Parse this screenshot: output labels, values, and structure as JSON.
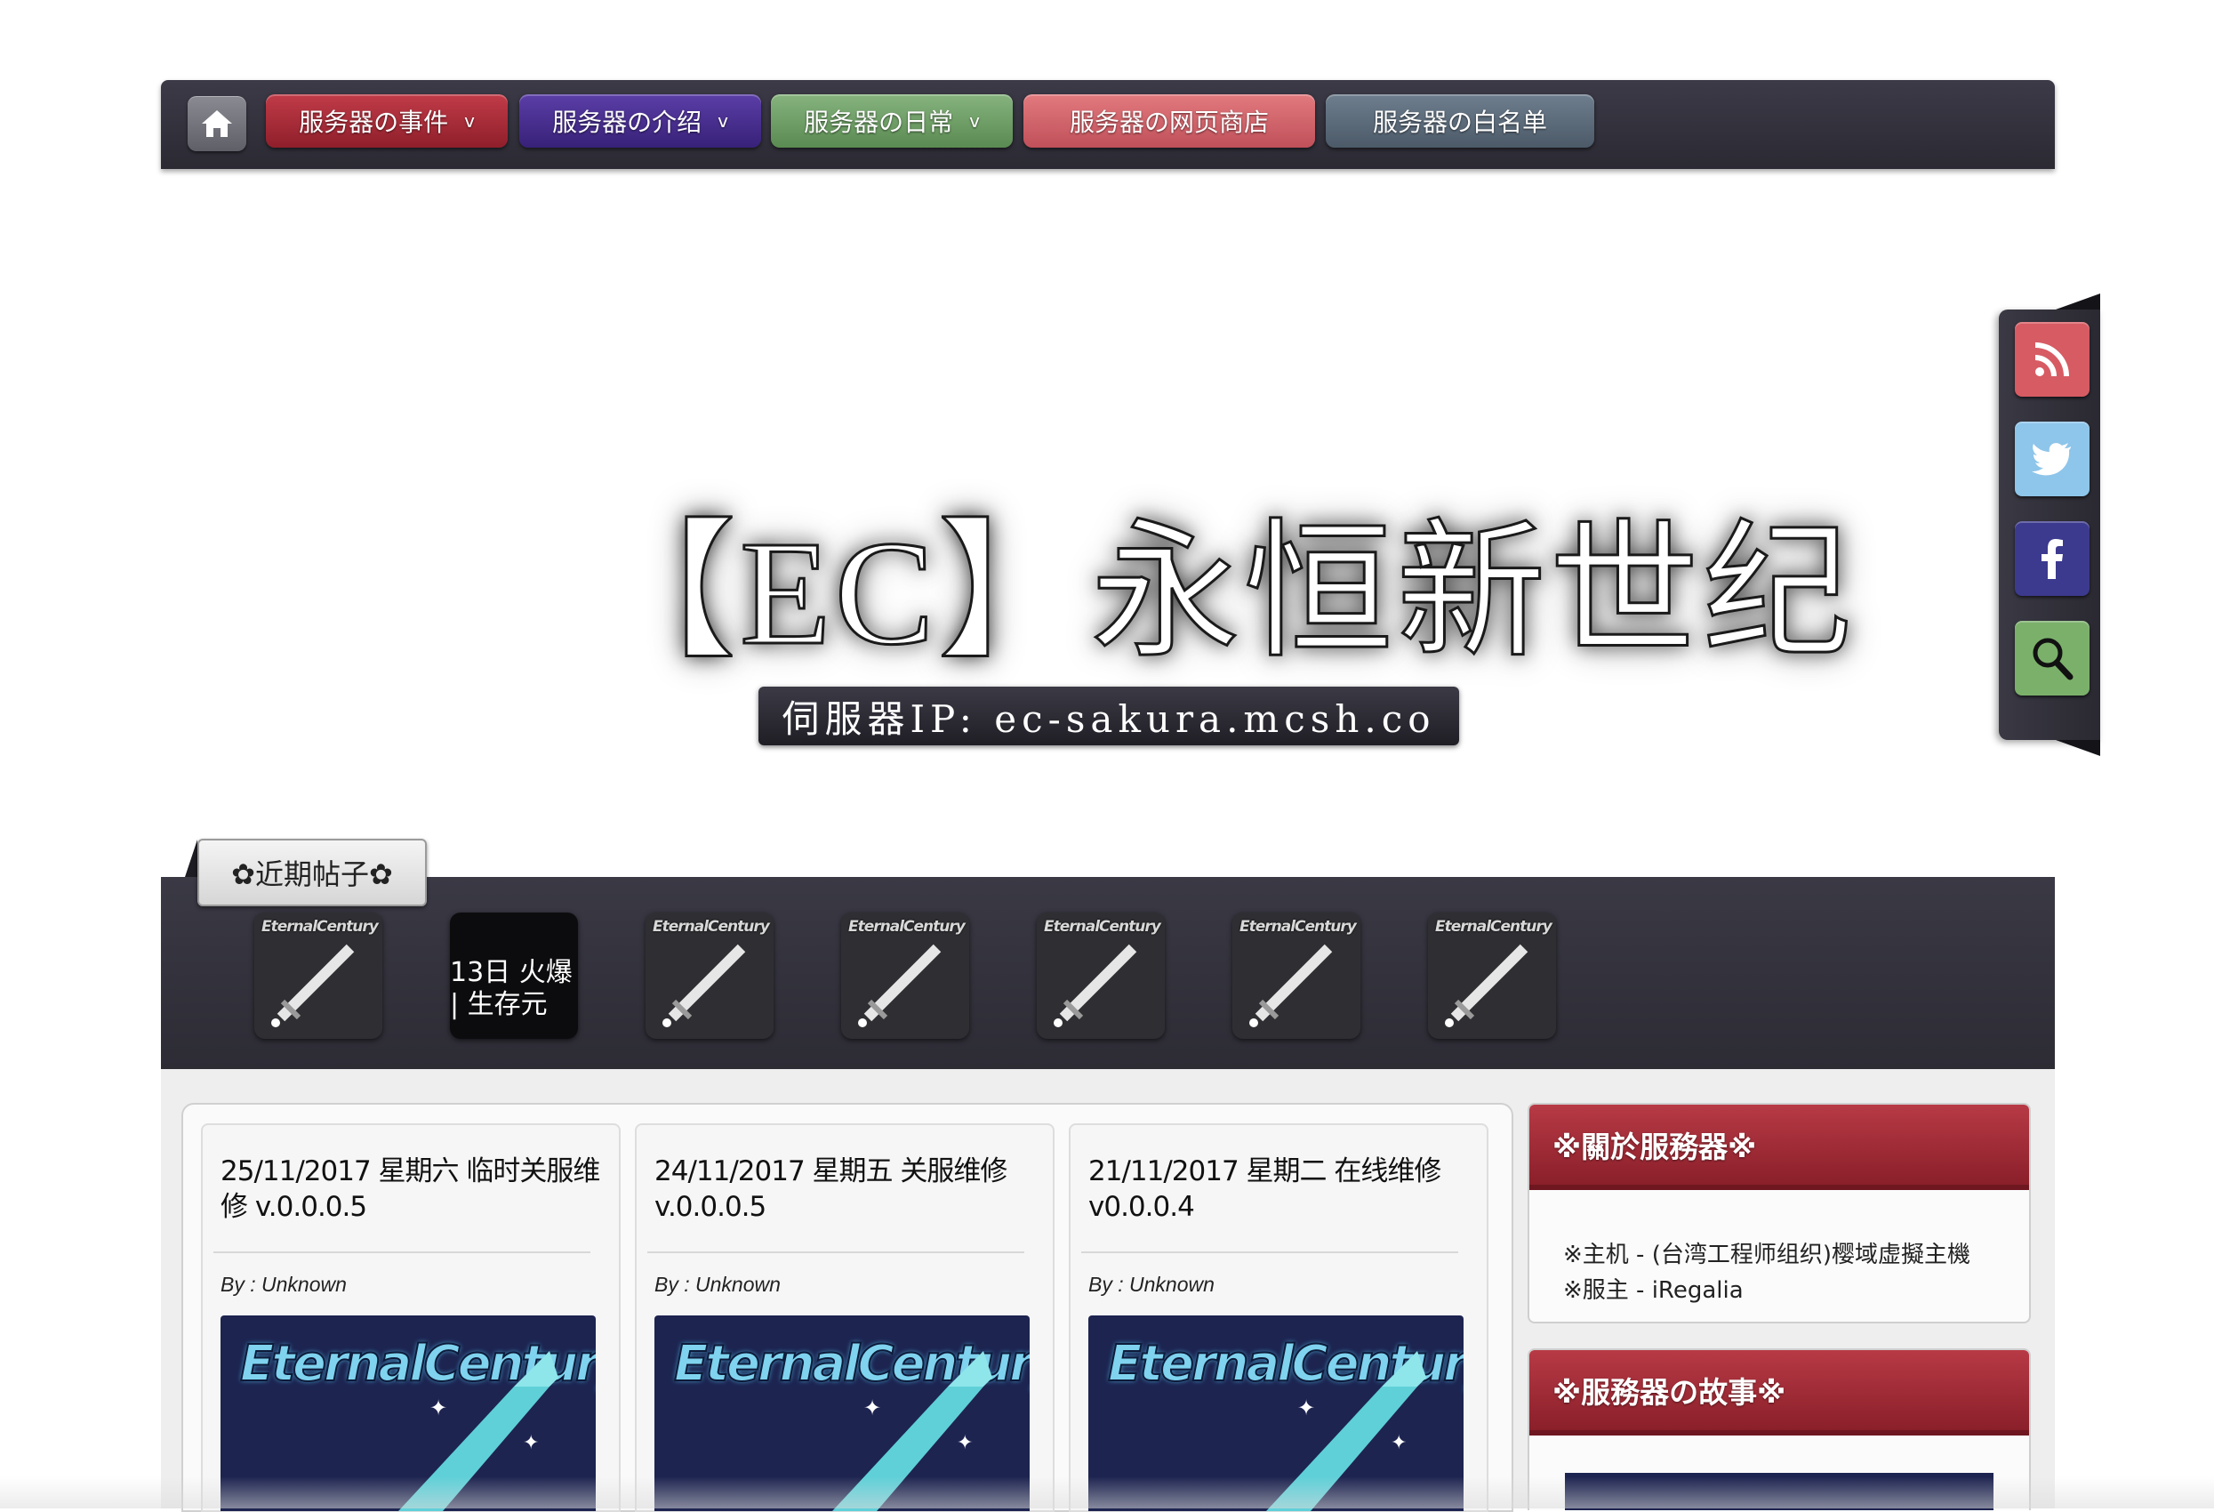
{
  "nav": {
    "home_icon": "home-icon",
    "items": [
      {
        "label": "服务器の事件",
        "has_dropdown": true,
        "color": "#c13b48"
      },
      {
        "label": "服务器の介绍",
        "has_dropdown": true,
        "color": "#5b3ea7"
      },
      {
        "label": "服务器の日常",
        "has_dropdown": true,
        "color": "#86b37e"
      },
      {
        "label": "服务器の网页商店",
        "has_dropdown": false,
        "color": "#e27a7e"
      },
      {
        "label": "服务器の白名单",
        "has_dropdown": false,
        "color": "#6e7e8e"
      }
    ],
    "caret": "v"
  },
  "hero": {
    "title": "【EC】永恒新世纪",
    "server_ip": "伺服器IP: ec-sakura.mcsh.co"
  },
  "social": {
    "items": [
      {
        "name": "rss-icon",
        "color": "#d75b63"
      },
      {
        "name": "twitter-icon",
        "color": "#8ec5ea"
      },
      {
        "name": "facebook-icon",
        "color": "#3c3a8e"
      },
      {
        "name": "search-icon",
        "color": "#7bb06b"
      }
    ]
  },
  "recent": {
    "tab_label": "✿近期帖子✿",
    "thumb_logo": "EternalCentury",
    "dark_thumb_lines": [
      "13日 火爆",
      "| 生存元"
    ]
  },
  "posts": [
    {
      "title": "25/11/2017 星期六 临时关服维修 v.0.0.0.5",
      "author": "By : Unknown",
      "image_brand": "EternalCentury"
    },
    {
      "title": "24/11/2017 星期五 关服维修 v.0.0.0.5",
      "author": "By : Unknown",
      "image_brand": "EternalCentury"
    },
    {
      "title": "21/11/2017 星期二 在线维修 v0.0.0.4",
      "author": "By : Unknown",
      "image_brand": "EternalCentury"
    }
  ],
  "sidebar": {
    "about": {
      "title": "※關於服務器※",
      "lines": [
        "※主机 - (台湾工程师组织)樱域虚擬主機",
        "※服主 - iRegalia"
      ]
    },
    "story": {
      "title": "※服務器の故事※"
    }
  }
}
